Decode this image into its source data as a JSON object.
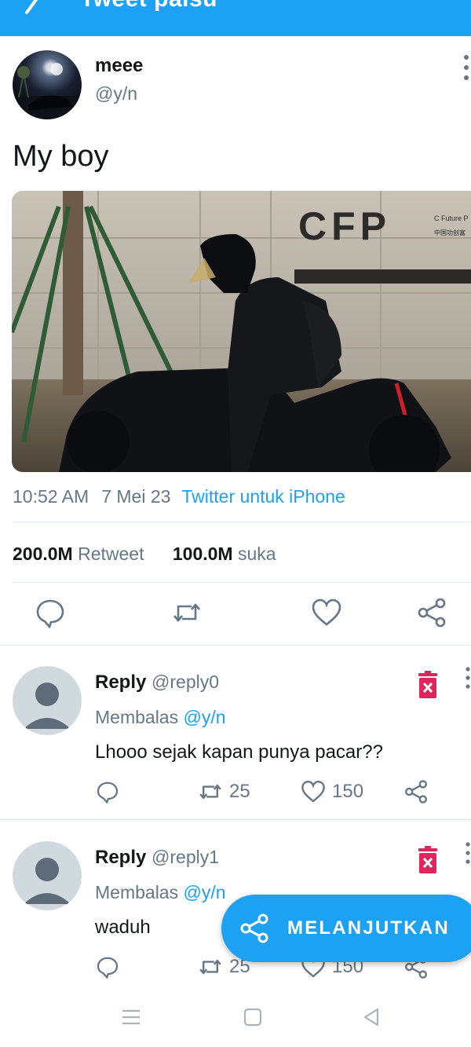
{
  "app_bar": {
    "title": "Tweet palsu"
  },
  "tweet": {
    "name": "meee",
    "handle": "@y/n",
    "text": "My boy",
    "photo_sign_text": "CFP",
    "photo_sign_small1": "C Future P",
    "photo_sign_small2": "中国功创富",
    "time": "10:52 AM",
    "date": "7 Mei 23",
    "source": "Twitter untuk iPhone",
    "retweets_count": "200.0M",
    "retweets_label": "Retweet",
    "likes_count": "100.0M",
    "likes_label": "suka"
  },
  "replies": [
    {
      "name": "Reply",
      "handle": "@reply0",
      "replying_prefix": "Membalas",
      "replying_handle": "@y/n",
      "text": "Lhooo sejak kapan punya pacar??",
      "retweets": "25",
      "likes": "150"
    },
    {
      "name": "Reply",
      "handle": "@reply1",
      "replying_prefix": "Membalas",
      "replying_handle": "@y/n",
      "text": "waduh",
      "retweets": "25",
      "likes": "150"
    }
  ],
  "fab": {
    "label": "MELANJUTKAN"
  },
  "colors": {
    "accent": "#1da1f2",
    "delete": "#e0245e",
    "muted": "#657786"
  },
  "icons": [
    "back-arrow-icon",
    "more-vert-icon",
    "reply-icon",
    "retweet-icon",
    "heart-icon",
    "share-icon",
    "trash-icon",
    "nav-menu-icon",
    "nav-home-icon",
    "nav-back-icon"
  ]
}
